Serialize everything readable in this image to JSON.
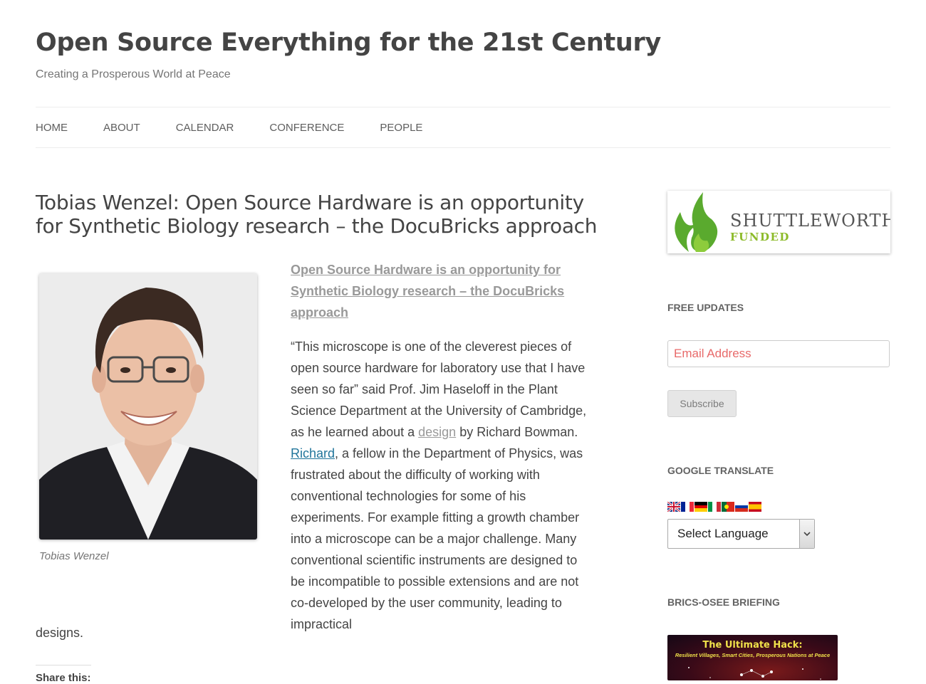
{
  "site": {
    "title": "Open Source Everything for the 21st Century",
    "tagline": "Creating a Prosperous World at Peace"
  },
  "nav": {
    "items": [
      "HOME",
      "ABOUT",
      "CALENDAR",
      "CONFERENCE",
      "PEOPLE"
    ]
  },
  "post": {
    "title": "Tobias Wenzel: Open Source Hardware is an opportunity for Synthetic Biology research – the DocuBricks approach",
    "image_caption": "Tobias Wenzel",
    "lead_link": "Open Source Hardware is an opportunity for Synthetic Biology research – the DocuBricks approach",
    "p1_start": "“This microscope is one of the cleverest pieces of open source hardware for laboratory use that I have seen so far” said Prof. Jim Haseloff in the Plant Science Department at the University of Cambridge, as he learned about a ",
    "p1_link_design": "design",
    "p1_mid": " by Richard Bowman. ",
    "p1_link_richard": "Richard",
    "p1_end": ", a fellow in the Department of Physics, was frustrated about the difficulty of working with conventional technologies for some of his experiments. For example fitting a growth chamber into a microscope can be a major challenge. Many conventional scientific instruments are designed to be incompatible to possible extensions and are not co-developed by the user community, leading to impractical",
    "p1_tail": "designs.",
    "share_label": "Share this:"
  },
  "sidebar": {
    "banner": {
      "name": "SHUTTLEWORTH",
      "sub": "FUNDED",
      "flame_color": "#5aaa2e",
      "text_color": "#555555",
      "sub_color": "#8dbb2a"
    },
    "free_updates": {
      "title": "FREE UPDATES",
      "email_placeholder": "Email Address",
      "subscribe_label": "Subscribe"
    },
    "translate": {
      "title": "GOOGLE TRANSLATE",
      "flags": [
        "uk-flag-icon",
        "france-flag-icon",
        "germany-flag-icon",
        "italy-flag-icon",
        "portugal-flag-icon",
        "russia-flag-icon",
        "spain-flag-icon"
      ],
      "selected": "Select Language"
    },
    "briefing": {
      "title": "BRICS-OSEE BRIEFING",
      "book_title": "The Ultimate Hack:",
      "book_subtitle": "Resilient Villages, Smart Cities, Prosperous Nations at Peace"
    }
  }
}
